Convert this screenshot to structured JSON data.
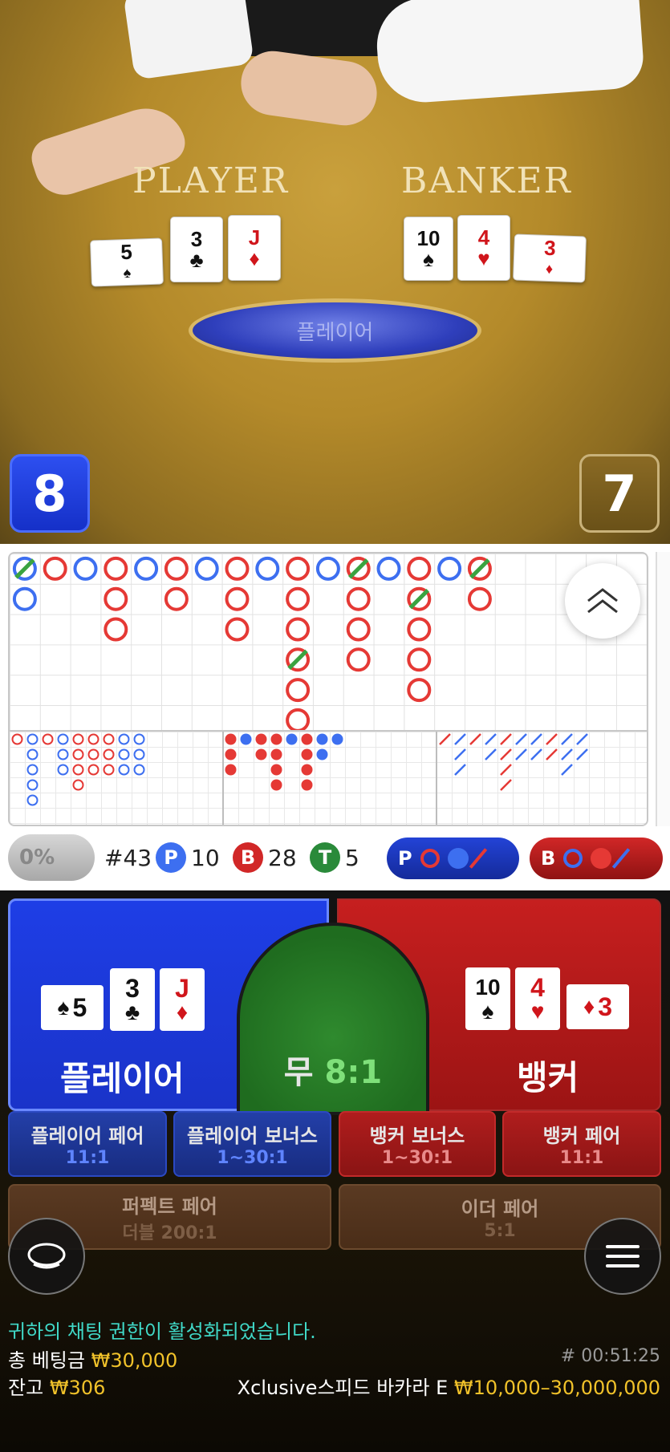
{
  "table": {
    "player_label": "PLAYER",
    "banker_label": "BANKER",
    "result_text": "플레이어",
    "player_score": "8",
    "banker_score": "7",
    "player_cards": [
      {
        "rank": "5",
        "suit": "♠",
        "color": "black"
      },
      {
        "rank": "3",
        "suit": "♣",
        "color": "black"
      },
      {
        "rank": "J",
        "suit": "♦",
        "color": "red"
      }
    ],
    "banker_cards": [
      {
        "rank": "10",
        "suit": "♠",
        "color": "black"
      },
      {
        "rank": "4",
        "suit": "♥",
        "color": "red"
      },
      {
        "rank": "3",
        "suit": "♦",
        "color": "red"
      }
    ]
  },
  "stats": {
    "percent": "0%",
    "round": "#43",
    "player_letter": "P",
    "player_count": "10",
    "banker_letter": "B",
    "banker_count": "28",
    "tie_letter": "T",
    "tie_count": "5",
    "predict_player_letter": "P",
    "predict_banker_letter": "B"
  },
  "bets": {
    "player_label": "플레이어",
    "tie_label": "무",
    "tie_odds": "8:1",
    "banker_label": "뱅커",
    "side": [
      {
        "title": "플레이어 페어",
        "odds": "11:1"
      },
      {
        "title": "플레이어 보너스",
        "odds": "1~30:1"
      },
      {
        "title": "뱅커 보너스",
        "odds": "1~30:1"
      },
      {
        "title": "뱅커 페어",
        "odds": "11:1"
      },
      {
        "title": "퍼펙트 페어",
        "odds": "더블 200:1"
      },
      {
        "title": "이더 페어",
        "odds": "5:1"
      }
    ]
  },
  "footer": {
    "chat_message": "귀하의 채팅 권한이 활성화되었습니다.",
    "total_bet_label": "총 베팅금",
    "total_bet_value": "₩30,000",
    "balance_label": "잔고",
    "balance_value": "₩306",
    "table_name": "Xclusive스피드 바카라 E",
    "limits": "₩10,000–30,000,000",
    "time": "# 00:51:25"
  },
  "colors": {
    "player": "#1e3ee6",
    "banker": "#c61f1f",
    "tie": "#2f8a2e",
    "gold": "#f1c22a",
    "chat": "#40d9c8"
  }
}
